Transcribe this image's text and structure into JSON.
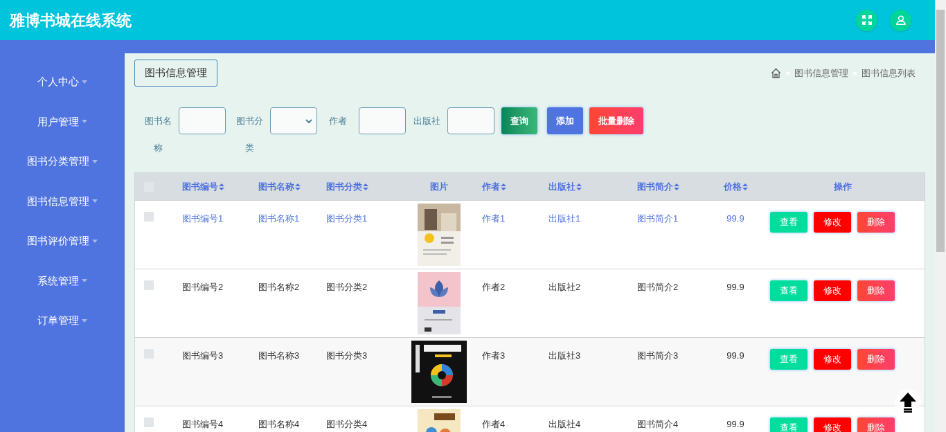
{
  "header": {
    "title": "雅博书城在线系统"
  },
  "sidebar": {
    "items": [
      {
        "label": "个人中心"
      },
      {
        "label": "用户管理"
      },
      {
        "label": "图书分类管理"
      },
      {
        "label": "图书信息管理"
      },
      {
        "label": "图书评价管理"
      },
      {
        "label": "系统管理"
      },
      {
        "label": "订单管理"
      }
    ]
  },
  "page_title": "图书信息管理",
  "breadcrumb": [
    "图书信息管理",
    "图书信息列表"
  ],
  "filters": [
    {
      "kind": "input",
      "label": "图书名称"
    },
    {
      "kind": "select",
      "label": "图书分类"
    },
    {
      "kind": "input",
      "label": "作者"
    },
    {
      "kind": "input",
      "label": "出版社"
    }
  ],
  "actions": [
    {
      "kind": "search",
      "label": "查询"
    },
    {
      "kind": "add",
      "label": "添加"
    },
    {
      "kind": "bulk_delete",
      "label": "批量删除"
    }
  ],
  "table": {
    "header_checked": false,
    "columns": [
      {
        "label": "图书编号",
        "sortable": true
      },
      {
        "label": "图书名称",
        "sortable": true
      },
      {
        "label": "图书分类",
        "sortable": true
      },
      {
        "label": "图片",
        "sortable": false
      },
      {
        "label": "作者",
        "sortable": true
      },
      {
        "label": "出版社",
        "sortable": true
      },
      {
        "label": "图书简介",
        "sortable": true
      },
      {
        "label": "价格",
        "sortable": true
      },
      {
        "label": "操作",
        "sortable": false
      }
    ],
    "rows": [
      {
        "checked": false,
        "hovered": true,
        "cells": [
          "图书编号1",
          "图书名称1",
          "图书分类1",
          {
            "kind": "picture"
          },
          "作者1",
          "出版社1",
          "图书简介1",
          "99.9",
          {
            "kind": "buttons",
            "buttons": [
              {
                "kind": "view",
                "label": "查看"
              },
              {
                "kind": "edit",
                "label": "修改"
              },
              {
                "kind": "delete",
                "label": "删除"
              }
            ]
          }
        ]
      },
      {
        "checked": false,
        "hovered": false,
        "cells": [
          "图书编号2",
          "图书名称2",
          "图书分类2",
          {
            "kind": "picture"
          },
          "作者2",
          "出版社2",
          "图书简介2",
          "99.9",
          {
            "kind": "buttons",
            "buttons": [
              {
                "kind": "view",
                "label": "查看"
              },
              {
                "kind": "edit",
                "label": "修改"
              },
              {
                "kind": "delete",
                "label": "删除"
              }
            ]
          }
        ]
      },
      {
        "checked": false,
        "hovered": false,
        "cells": [
          "图书编号3",
          "图书名称3",
          "图书分类3",
          {
            "kind": "picture"
          },
          "作者3",
          "出版社3",
          "图书简介3",
          "99.9",
          {
            "kind": "buttons",
            "buttons": [
              {
                "kind": "view",
                "label": "查看"
              },
              {
                "kind": "edit",
                "label": "修改"
              },
              {
                "kind": "delete",
                "label": "删除"
              }
            ]
          }
        ]
      },
      {
        "checked": false,
        "hovered": false,
        "cells": [
          "图书编号4",
          "图书名称4",
          "图书分类4",
          {
            "kind": "picture"
          },
          "作者4",
          "出版社4",
          "图书简介4",
          "99.9",
          {
            "kind": "buttons",
            "buttons": [
              {
                "kind": "view",
                "label": "查看"
              },
              {
                "kind": "edit",
                "label": "修改"
              },
              {
                "kind": "delete",
                "label": "删除"
              }
            ]
          }
        ]
      }
    ]
  }
}
